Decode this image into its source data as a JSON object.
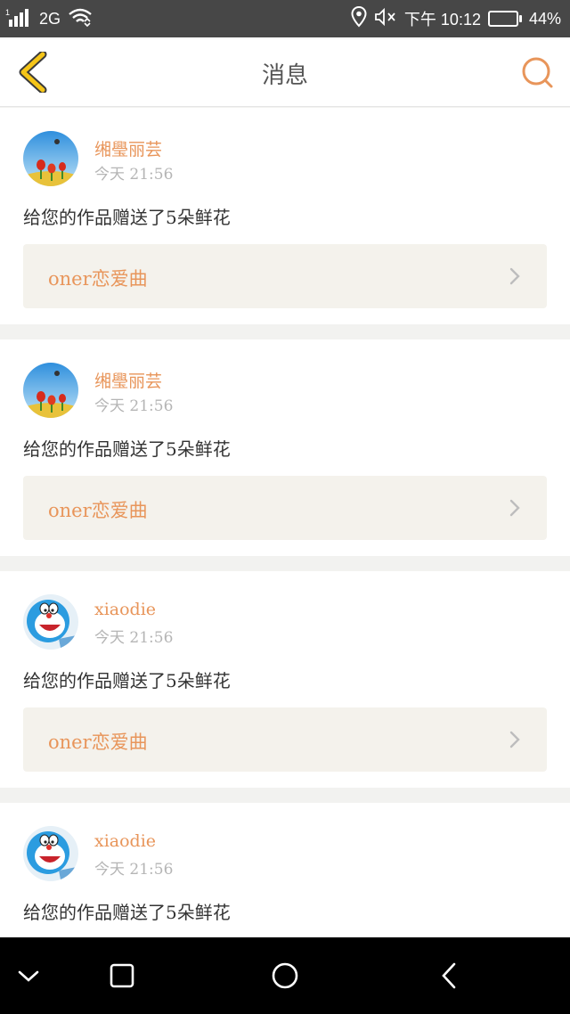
{
  "status_bar": {
    "signal_label": "1",
    "network": "2G",
    "time": "下午 10:12",
    "battery_percent": "44%",
    "battery_level": 0.44,
    "icons": [
      "signal-icon",
      "wifi-icon",
      "location-icon",
      "mute-icon",
      "battery-icon"
    ]
  },
  "header": {
    "title": "消息",
    "back_icon": "chevron-left-icon",
    "search_icon": "search-icon",
    "accent_color": "#e8955a",
    "back_color": "#f5c518"
  },
  "messages": [
    {
      "username": "缃璺丽芸",
      "time": "今天  21:56",
      "text": "给您的作品赠送了5朵鲜花",
      "work_title": "oner恋爱曲",
      "avatar": "tulip-avatar"
    },
    {
      "username": "缃璺丽芸",
      "time": "今天  21:56",
      "text": "给您的作品赠送了5朵鲜花",
      "work_title": "oner恋爱曲",
      "avatar": "tulip-avatar"
    },
    {
      "username": "xiaodie",
      "time": "今天  21:56",
      "text": "给您的作品赠送了5朵鲜花",
      "work_title": "oner恋爱曲",
      "avatar": "doraemon-avatar"
    },
    {
      "username": "xiaodie",
      "time": "今天  21:56",
      "text": "给您的作品赠送了5朵鲜花",
      "work_title": "",
      "avatar": "doraemon-avatar"
    }
  ],
  "nav_bar": {
    "icons": [
      "collapse-icon",
      "recent-apps-icon",
      "home-icon",
      "back-icon"
    ]
  }
}
